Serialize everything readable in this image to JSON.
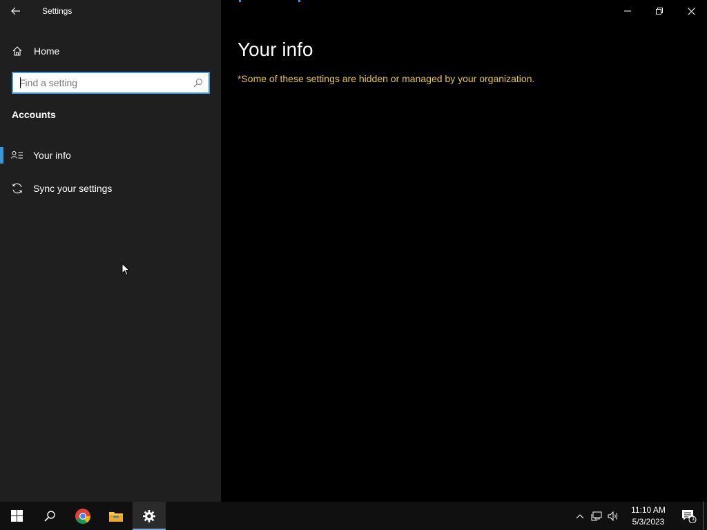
{
  "window": {
    "title": "Settings"
  },
  "sidebar": {
    "home_label": "Home",
    "search_placeholder": "Find a setting",
    "section_heading": "Accounts",
    "items": [
      {
        "label": "Your info",
        "icon": "person-list-icon",
        "selected": true
      },
      {
        "label": "Sync your settings",
        "icon": "sync-icon",
        "selected": false
      }
    ]
  },
  "content": {
    "title": "Your info",
    "notice": "*Some of these settings are hidden or managed by your organization.",
    "notice_color": "#e8c73a"
  },
  "taskbar": {
    "apps": [
      {
        "name": "start",
        "icon": "windows-logo-icon"
      },
      {
        "name": "search",
        "icon": "search-icon"
      },
      {
        "name": "chrome",
        "icon": "chrome-icon"
      },
      {
        "name": "file-explorer",
        "icon": "folder-icon"
      },
      {
        "name": "settings",
        "icon": "gear-icon",
        "active": true
      }
    ],
    "clock_time": "11:10 AM",
    "clock_date": "5/3/2023",
    "notification_count": "1"
  },
  "colors": {
    "accent": "#3a96dd",
    "sidebar_bg": "#1f1f1f",
    "content_bg": "#000000"
  }
}
